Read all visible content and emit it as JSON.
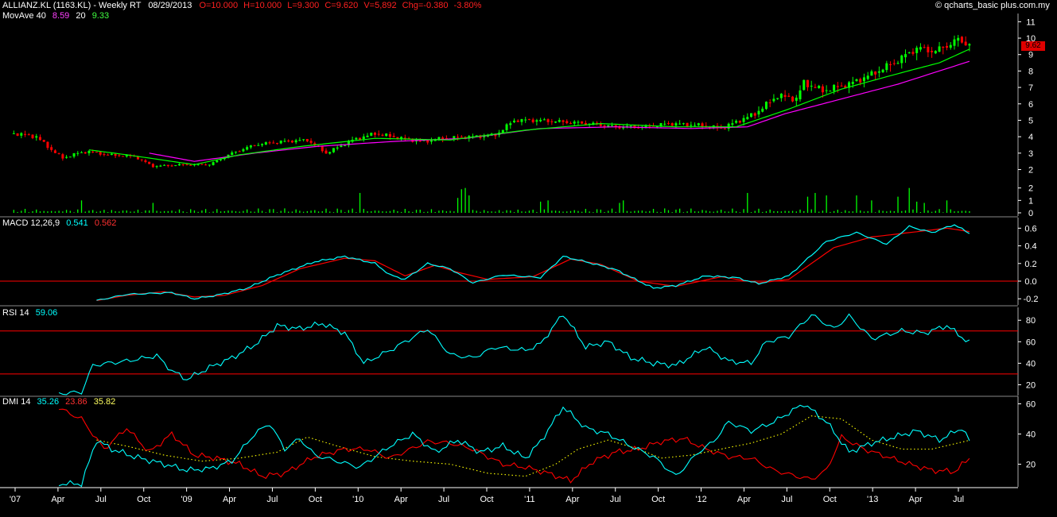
{
  "header": {
    "symbol": "ALLIANZ.KL (1163.KL) - Weekly RT",
    "date": "08/29/2013",
    "quote": [
      "O=10.000",
      "H=10.000",
      "L=9.300",
      "C=9.620",
      "V=5,892",
      "Chg=-0.380",
      "-3.80%"
    ],
    "copyright": "© qcharts_basic plus.com.my"
  },
  "mov_ave": {
    "label": "MovAve 40",
    "v1": "8.59",
    "p2": "20",
    "v2": "9.33"
  },
  "macd_legend": {
    "label": "MACD 12,26,9",
    "v1": "0.541",
    "v2": "0.562"
  },
  "rsi_legend": {
    "label": "RSI 14",
    "v1": "59.06"
  },
  "dmi_legend": {
    "label": "DMI 14",
    "v1": "35.26",
    "v2": "23.86",
    "v3": "35.82"
  },
  "last_price_tag": "9.62",
  "colors": {
    "bg": "#000000",
    "up": "#00ff00",
    "down": "#ff0000",
    "ma20": "#00ff00",
    "ma40": "#ff00ff",
    "macd": "#00ffff",
    "signal": "#ff0000",
    "rsi": "#00ffff",
    "ref": "#ff0000",
    "dmi_plus": "#00ffff",
    "dmi_minus": "#ff0000",
    "adx": "#ffff00",
    "grid": "#ffffff"
  },
  "chart_data": [
    {
      "type": "candlestick",
      "x_ticks": [
        "'07",
        "Apr",
        "Jul",
        "Oct",
        "'09",
        "Apr",
        "Jul",
        "Oct",
        "'10",
        "Apr",
        "Jul",
        "Oct",
        "'11",
        "Apr",
        "Jul",
        "Oct",
        "'12",
        "Apr",
        "Jul",
        "Oct",
        "'13",
        "Apr",
        "Jul"
      ],
      "y_ticks": [
        2,
        3,
        4,
        5,
        6,
        7,
        8,
        9,
        10,
        11
      ],
      "ylim": [
        1.3,
        11.5
      ],
      "close_anchors": [
        [
          0,
          4.2
        ],
        [
          6,
          4.0
        ],
        [
          10,
          3.2
        ],
        [
          13,
          2.7
        ],
        [
          17,
          3.0
        ],
        [
          20,
          3.1
        ],
        [
          25,
          2.9
        ],
        [
          32,
          2.8
        ],
        [
          37,
          2.2
        ],
        [
          45,
          2.3
        ],
        [
          52,
          2.3
        ],
        [
          58,
          3.0
        ],
        [
          64,
          3.5
        ],
        [
          71,
          3.7
        ],
        [
          78,
          3.8
        ],
        [
          83,
          3.0
        ],
        [
          90,
          3.8
        ],
        [
          96,
          4.2
        ],
        [
          103,
          3.9
        ],
        [
          109,
          3.7
        ],
        [
          114,
          3.9
        ],
        [
          122,
          4.0
        ],
        [
          128,
          4.1
        ],
        [
          133,
          5.0
        ],
        [
          139,
          5.0
        ],
        [
          146,
          4.9
        ],
        [
          153,
          4.8
        ],
        [
          160,
          4.6
        ],
        [
          168,
          4.6
        ],
        [
          174,
          4.8
        ],
        [
          182,
          4.7
        ],
        [
          188,
          4.5
        ],
        [
          192,
          4.9
        ],
        [
          197,
          5.4
        ],
        [
          203,
          6.5
        ],
        [
          208,
          6.3
        ],
        [
          210,
          7.3
        ],
        [
          215,
          6.8
        ],
        [
          222,
          7.2
        ],
        [
          228,
          7.8
        ],
        [
          234,
          8.5
        ],
        [
          240,
          9.4
        ],
        [
          245,
          9.2
        ],
        [
          251,
          9.9
        ],
        [
          254,
          9.62
        ]
      ],
      "ma40_anchors": [
        [
          36,
          3.0
        ],
        [
          48,
          2.5
        ],
        [
          64,
          3.0
        ],
        [
          80,
          3.4
        ],
        [
          100,
          3.7
        ],
        [
          120,
          3.9
        ],
        [
          140,
          4.5
        ],
        [
          160,
          4.6
        ],
        [
          180,
          4.5
        ],
        [
          195,
          4.6
        ],
        [
          205,
          5.4
        ],
        [
          220,
          6.3
        ],
        [
          235,
          7.2
        ],
        [
          254,
          8.59
        ]
      ],
      "ma20_anchors": [
        [
          20,
          3.2
        ],
        [
          30,
          2.9
        ],
        [
          48,
          2.3
        ],
        [
          60,
          2.9
        ],
        [
          76,
          3.4
        ],
        [
          96,
          3.9
        ],
        [
          116,
          3.8
        ],
        [
          136,
          4.4
        ],
        [
          156,
          4.8
        ],
        [
          176,
          4.6
        ],
        [
          192,
          4.6
        ],
        [
          205,
          5.6
        ],
        [
          220,
          6.9
        ],
        [
          236,
          7.9
        ],
        [
          246,
          8.5
        ],
        [
          254,
          9.33
        ]
      ]
    },
    {
      "type": "bar",
      "name": "Volume",
      "y_ticks": [
        0,
        1,
        2
      ],
      "ylim": [
        0,
        2.3
      ],
      "spikes": [
        [
          18,
          1.0
        ],
        [
          37,
          0.8
        ],
        [
          92,
          1.6
        ],
        [
          118,
          1.2
        ],
        [
          119,
          1.9
        ],
        [
          120,
          2.0
        ],
        [
          121,
          1.4
        ],
        [
          140,
          0.9
        ],
        [
          142,
          1.0
        ],
        [
          161,
          0.8
        ],
        [
          162,
          1.0
        ],
        [
          195,
          1.6
        ],
        [
          211,
          1.3
        ],
        [
          213,
          1.6
        ],
        [
          216,
          1.4
        ],
        [
          224,
          1.4
        ],
        [
          228,
          1.0
        ],
        [
          235,
          1.3
        ],
        [
          238,
          2.0
        ],
        [
          240,
          0.9
        ],
        [
          242,
          0.8
        ],
        [
          248,
          1.0
        ]
      ]
    },
    {
      "type": "line",
      "name": "MACD 12,26,9",
      "y_ticks": [
        -0.2,
        0.0,
        0.2,
        0.4,
        0.6
      ],
      "ylim": [
        -0.27,
        0.72
      ],
      "ref_lines": [
        0.0
      ],
      "macd_anchors": [
        [
          22,
          -0.22
        ],
        [
          30,
          -0.15
        ],
        [
          36,
          -0.14
        ],
        [
          42,
          -0.13
        ],
        [
          48,
          -0.2
        ],
        [
          54,
          -0.16
        ],
        [
          62,
          -0.08
        ],
        [
          70,
          0.07
        ],
        [
          80,
          0.22
        ],
        [
          88,
          0.28
        ],
        [
          96,
          0.2
        ],
        [
          100,
          0.07
        ],
        [
          104,
          0.02
        ],
        [
          110,
          0.2
        ],
        [
          116,
          0.14
        ],
        [
          122,
          -0.02
        ],
        [
          130,
          0.07
        ],
        [
          140,
          0.04
        ],
        [
          146,
          0.28
        ],
        [
          152,
          0.22
        ],
        [
          160,
          0.13
        ],
        [
          170,
          -0.08
        ],
        [
          176,
          -0.05
        ],
        [
          184,
          0.06
        ],
        [
          192,
          0.04
        ],
        [
          198,
          -0.03
        ],
        [
          206,
          0.06
        ],
        [
          216,
          0.45
        ],
        [
          224,
          0.55
        ],
        [
          232,
          0.42
        ],
        [
          238,
          0.62
        ],
        [
          244,
          0.55
        ],
        [
          250,
          0.64
        ],
        [
          254,
          0.541
        ]
      ],
      "signal_anchors": [
        [
          22,
          -0.22
        ],
        [
          30,
          -0.16
        ],
        [
          40,
          -0.12
        ],
        [
          48,
          -0.18
        ],
        [
          56,
          -0.16
        ],
        [
          66,
          -0.05
        ],
        [
          76,
          0.14
        ],
        [
          88,
          0.26
        ],
        [
          96,
          0.23
        ],
        [
          104,
          0.06
        ],
        [
          112,
          0.18
        ],
        [
          118,
          0.1
        ],
        [
          126,
          0.02
        ],
        [
          138,
          0.05
        ],
        [
          148,
          0.25
        ],
        [
          156,
          0.19
        ],
        [
          166,
          0.0
        ],
        [
          176,
          -0.06
        ],
        [
          188,
          0.05
        ],
        [
          198,
          -0.02
        ],
        [
          206,
          0.02
        ],
        [
          218,
          0.38
        ],
        [
          228,
          0.5
        ],
        [
          238,
          0.55
        ],
        [
          248,
          0.6
        ],
        [
          254,
          0.562
        ]
      ]
    },
    {
      "type": "line",
      "name": "RSI 14",
      "y_ticks": [
        20,
        40,
        60,
        80
      ],
      "ylim": [
        10,
        92
      ],
      "ref_lines": [
        30,
        70
      ],
      "anchors": [
        [
          12,
          12
        ],
        [
          18,
          13
        ],
        [
          21,
          38
        ],
        [
          25,
          40
        ],
        [
          30,
          42
        ],
        [
          38,
          47
        ],
        [
          42,
          33
        ],
        [
          46,
          25
        ],
        [
          52,
          36
        ],
        [
          58,
          45
        ],
        [
          64,
          57
        ],
        [
          70,
          75
        ],
        [
          76,
          72
        ],
        [
          82,
          77
        ],
        [
          88,
          68
        ],
        [
          93,
          40
        ],
        [
          100,
          52
        ],
        [
          110,
          72
        ],
        [
          116,
          48
        ],
        [
          122,
          45
        ],
        [
          128,
          55
        ],
        [
          136,
          52
        ],
        [
          140,
          58
        ],
        [
          146,
          86
        ],
        [
          152,
          55
        ],
        [
          158,
          60
        ],
        [
          164,
          45
        ],
        [
          170,
          40
        ],
        [
          176,
          38
        ],
        [
          184,
          55
        ],
        [
          190,
          42
        ],
        [
          196,
          40
        ],
        [
          200,
          60
        ],
        [
          206,
          65
        ],
        [
          212,
          85
        ],
        [
          218,
          72
        ],
        [
          222,
          84
        ],
        [
          228,
          63
        ],
        [
          236,
          70
        ],
        [
          242,
          68
        ],
        [
          248,
          75
        ],
        [
          254,
          59
        ]
      ]
    },
    {
      "type": "line",
      "name": "DMI 14",
      "y_ticks": [
        20,
        40,
        60
      ],
      "ylim": [
        5,
        65
      ],
      "plus_anchors": [
        [
          12,
          7
        ],
        [
          18,
          7
        ],
        [
          22,
          36
        ],
        [
          26,
          30
        ],
        [
          32,
          25
        ],
        [
          40,
          20
        ],
        [
          46,
          16
        ],
        [
          52,
          17
        ],
        [
          58,
          22
        ],
        [
          64,
          40
        ],
        [
          68,
          47
        ],
        [
          72,
          30
        ],
        [
          76,
          37
        ],
        [
          80,
          26
        ],
        [
          86,
          22
        ],
        [
          92,
          18
        ],
        [
          100,
          32
        ],
        [
          106,
          40
        ],
        [
          112,
          28
        ],
        [
          118,
          36
        ],
        [
          124,
          28
        ],
        [
          130,
          32
        ],
        [
          136,
          24
        ],
        [
          140,
          35
        ],
        [
          146,
          58
        ],
        [
          152,
          44
        ],
        [
          158,
          40
        ],
        [
          164,
          32
        ],
        [
          170,
          25
        ],
        [
          176,
          12
        ],
        [
          182,
          28
        ],
        [
          186,
          35
        ],
        [
          190,
          48
        ],
        [
          196,
          42
        ],
        [
          202,
          48
        ],
        [
          210,
          60
        ],
        [
          216,
          48
        ],
        [
          222,
          28
        ],
        [
          228,
          34
        ],
        [
          234,
          38
        ],
        [
          240,
          42
        ],
        [
          246,
          36
        ],
        [
          252,
          44
        ],
        [
          254,
          35.26
        ]
      ],
      "minus_anchors": [
        [
          12,
          57
        ],
        [
          18,
          50
        ],
        [
          24,
          30
        ],
        [
          30,
          44
        ],
        [
          36,
          28
        ],
        [
          42,
          40
        ],
        [
          48,
          26
        ],
        [
          54,
          24
        ],
        [
          60,
          20
        ],
        [
          66,
          12
        ],
        [
          72,
          14
        ],
        [
          80,
          25
        ],
        [
          88,
          30
        ],
        [
          94,
          30
        ],
        [
          100,
          24
        ],
        [
          110,
          35
        ],
        [
          116,
          34
        ],
        [
          122,
          30
        ],
        [
          130,
          20
        ],
        [
          136,
          18
        ],
        [
          142,
          14
        ],
        [
          148,
          9
        ],
        [
          154,
          22
        ],
        [
          160,
          28
        ],
        [
          166,
          30
        ],
        [
          172,
          35
        ],
        [
          178,
          37
        ],
        [
          184,
          30
        ],
        [
          190,
          25
        ],
        [
          196,
          24
        ],
        [
          202,
          16
        ],
        [
          208,
          12
        ],
        [
          212,
          10
        ],
        [
          216,
          16
        ],
        [
          220,
          38
        ],
        [
          226,
          30
        ],
        [
          232,
          25
        ],
        [
          238,
          20
        ],
        [
          244,
          16
        ],
        [
          250,
          15
        ],
        [
          254,
          23.86
        ]
      ],
      "adx_anchors": [
        [
          22,
          36
        ],
        [
          30,
          32
        ],
        [
          40,
          26
        ],
        [
          50,
          22
        ],
        [
          60,
          24
        ],
        [
          70,
          28
        ],
        [
          78,
          38
        ],
        [
          86,
          32
        ],
        [
          96,
          25
        ],
        [
          106,
          22
        ],
        [
          116,
          20
        ],
        [
          126,
          14
        ],
        [
          136,
          12
        ],
        [
          144,
          20
        ],
        [
          150,
          30
        ],
        [
          158,
          36
        ],
        [
          166,
          30
        ],
        [
          172,
          24
        ],
        [
          180,
          26
        ],
        [
          188,
          30
        ],
        [
          196,
          34
        ],
        [
          204,
          40
        ],
        [
          212,
          52
        ],
        [
          220,
          50
        ],
        [
          228,
          36
        ],
        [
          236,
          30
        ],
        [
          244,
          30
        ],
        [
          254,
          35.82
        ]
      ]
    }
  ]
}
